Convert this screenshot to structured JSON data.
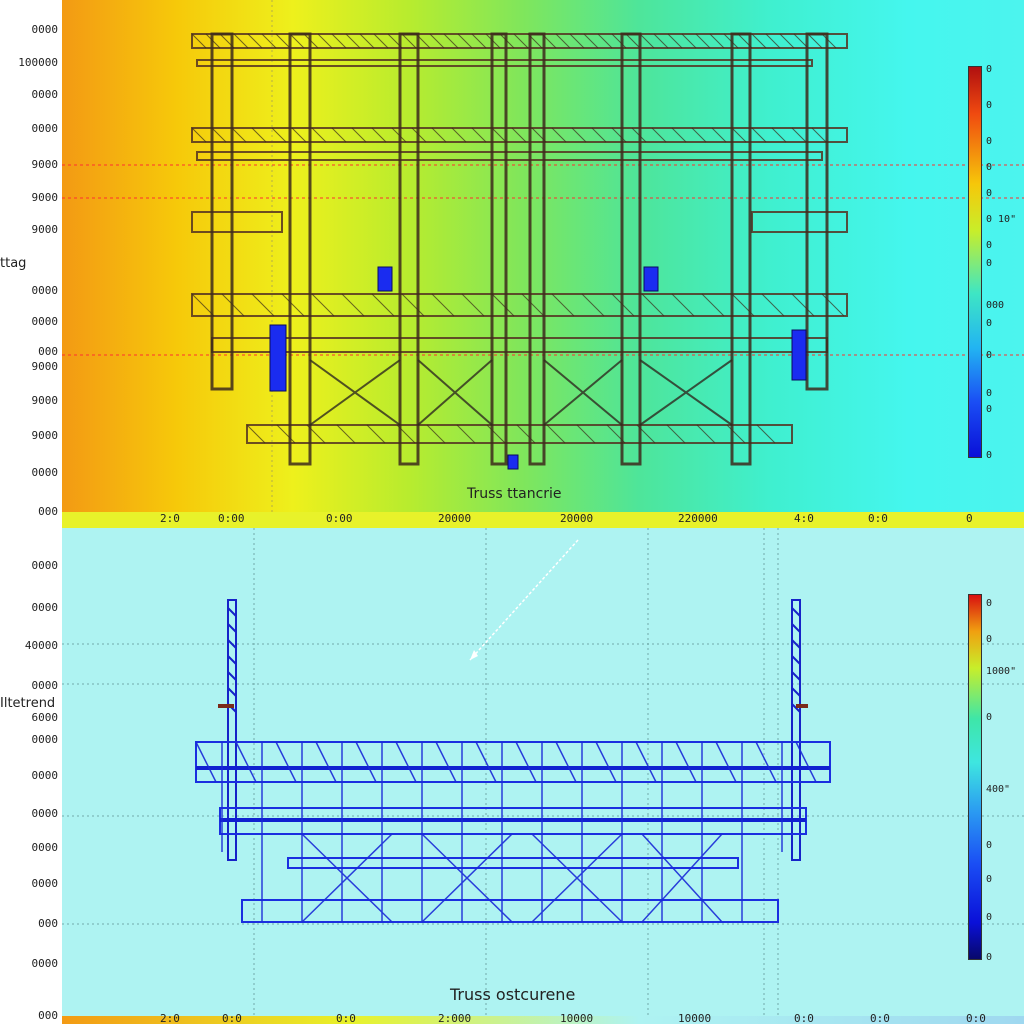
{
  "top": {
    "ylabel": "ttag",
    "caption": "Truss ttancrie",
    "yticks": [
      "0000",
      "100000",
      "0000",
      "0000",
      "9000",
      "9000",
      "9000",
      "0000",
      "0000",
      "000",
      "9000",
      "9000",
      "9000",
      "0000",
      "000"
    ],
    "xticks": [
      "2:0",
      "0:00",
      "0:00",
      "20000",
      "20000",
      "220000",
      "4:0",
      "0:0",
      "0"
    ],
    "cbar_ticks": [
      "0",
      "0",
      "0",
      "0",
      "0",
      "0 10\"",
      "0",
      "0",
      "000",
      "0",
      "0",
      "0",
      "0",
      "0"
    ]
  },
  "bottom": {
    "ylabel": "Iltetrend",
    "caption": "Truss ostcurene",
    "yticks": [
      "0000",
      "0000",
      "40000",
      "0000",
      "6000",
      "0000",
      "0000",
      "0000",
      "0000",
      "0000",
      "000",
      "0000",
      "000"
    ],
    "xticks": [
      "2:0",
      "0:0",
      "0:0",
      "2:000",
      "10000",
      "10000",
      "0:0",
      "0:0",
      "0:0"
    ],
    "cbar_ticks": [
      "0",
      "0",
      "1000\"",
      "0",
      "400\"",
      "0",
      "0",
      "0",
      "0"
    ]
  }
}
